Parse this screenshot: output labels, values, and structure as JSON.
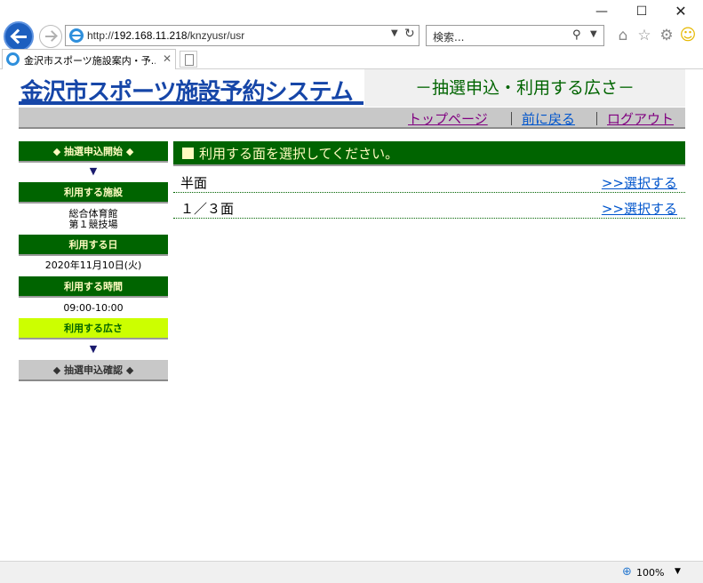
{
  "browser": {
    "window_controls": {
      "minimize": "—",
      "maximize": "☐",
      "close": "✕"
    },
    "address_prefix": "http://",
    "address_host": "192.168.11.218",
    "address_path": "/knzyusr/usr",
    "search_placeholder": "検索...",
    "tab_title": "金沢市スポーツ施設案内・予...",
    "zoom": "100%",
    "icons": [
      "back-icon",
      "forward-icon",
      "refresh-icon",
      "search-icon",
      "home-icon",
      "star-icon",
      "gear-icon",
      "smiley-icon",
      "zoom-icon"
    ]
  },
  "header": {
    "logo": "金沢市スポーツ施設予約システム",
    "page_heading": "－抽選申込・利用する広さ－"
  },
  "menu": {
    "top_page": "トップページ",
    "back": "前に戻る",
    "logout": "ログアウト",
    "separator": "｜"
  },
  "sidebar": {
    "start": "◆ 抽選申込開始 ◆",
    "arrow": "▼",
    "facility_label": "利用する施設",
    "facility_value_line1": "総合体育館",
    "facility_value_line2": "第１競技場",
    "date_label": "利用する日",
    "date_value": "2020年11月10日(火)",
    "time_label": "利用する時間",
    "time_value": "09:00-10:00",
    "size_label": "利用する広さ",
    "confirm": "◆ 抽選申込確認 ◆"
  },
  "main": {
    "instruction": "利用する面を選択してください。",
    "options": [
      {
        "name": "半面",
        "link": ">>選択する"
      },
      {
        "name": "１／３面",
        "link": ">>選択する"
      }
    ]
  },
  "colors": {
    "brand_green": "#006400",
    "current_step": "#ccff00",
    "logo_blue": "#1646a8",
    "link_blue": "#0055cc",
    "visited_purple": "#800080"
  }
}
